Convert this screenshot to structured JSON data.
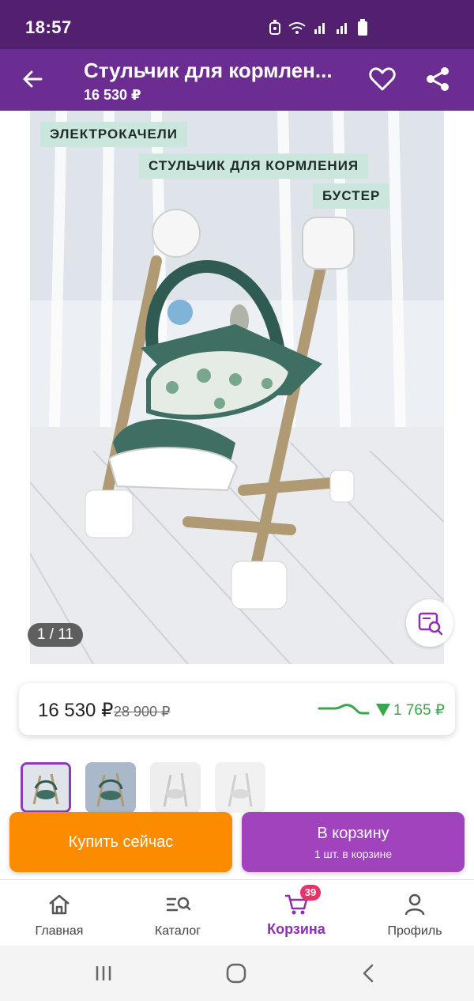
{
  "status_bar": {
    "time": "18:57",
    "icons": [
      "alarm-icon",
      "wifi-icon",
      "signal-icon",
      "signal-icon",
      "battery-icon"
    ]
  },
  "header": {
    "title": "Стульчик для кормлен...",
    "price": "16 530 ₽",
    "icons": [
      "back-arrow-icon",
      "heart-icon",
      "share-icon"
    ]
  },
  "gallery": {
    "tags": [
      "ЭЛЕКТРОКАЧЕЛИ",
      "СТУЛЬЧИК ДЛЯ КОРМЛЕНИЯ",
      "БУСТЕР"
    ],
    "counter": "1 / 11",
    "zoom_icon": "image-search-icon"
  },
  "price_card": {
    "current_price": "16 530 ₽",
    "old_price": "28 900 ₽",
    "price_drop": "1 765 ₽",
    "drop_color": "#3aa54a"
  },
  "actions": {
    "buy_now": "Купить сейчас",
    "add_to_cart": "В корзину",
    "in_cart_note": "1 шт. в корзине"
  },
  "bottom_nav": {
    "items": [
      {
        "label": "Главная",
        "icon": "home-icon"
      },
      {
        "label": "Каталог",
        "icon": "catalog-search-icon"
      },
      {
        "label": "Корзина",
        "icon": "cart-icon",
        "badge": "39",
        "active": true
      },
      {
        "label": "Профиль",
        "icon": "profile-icon"
      }
    ]
  },
  "colors": {
    "status_bar": "#52206e",
    "app_bar": "#6b2d91",
    "buy_button": "#fb8c00",
    "cart_button": "#a043bd",
    "active_nav": "#8e2fb0",
    "badge": "#e8336a"
  }
}
